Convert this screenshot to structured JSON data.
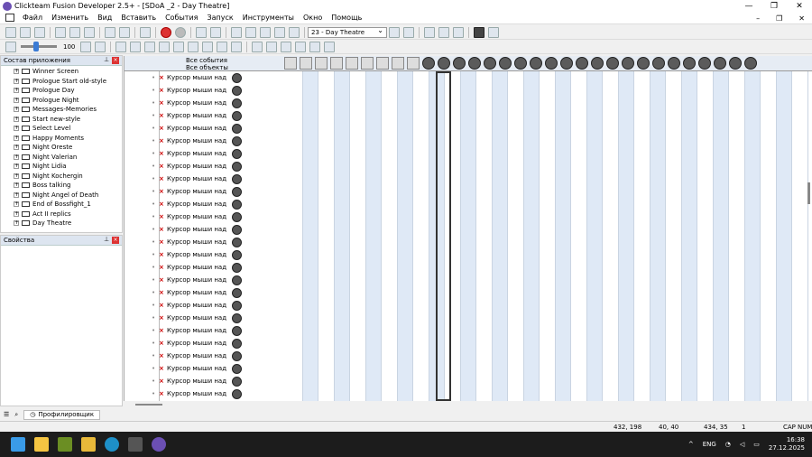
{
  "window": {
    "title": "Clickteam Fusion Developer 2.5+ - [SDoA _2 - Day Theatre]"
  },
  "menu": [
    "Файл",
    "Изменить",
    "Вид",
    "Вставить",
    "События",
    "Запуск",
    "Инструменты",
    "Окно",
    "Помощь"
  ],
  "toolbar": {
    "frame_select": "23 - Day Theatre",
    "zoom_value": "100"
  },
  "app_panel": {
    "title": "Состав приложения",
    "items": [
      "Winner Screen",
      "Prologue Start old-style",
      "Prologue Day",
      "Prologue Night",
      "Messages-Memories",
      "Start new-style",
      "Select Level",
      "Happy Moments",
      "Night Oreste",
      "Night Valerian",
      "Night Lidia",
      "Night Kochergin",
      "Boss talking",
      "Night Angel of Death",
      "End of Bossfight_1",
      "Act II replics",
      "Day Theatre"
    ]
  },
  "props_panel": {
    "title": "Свойства"
  },
  "editor": {
    "header_all_events": "Все события",
    "header_all_objects": "Все объекты",
    "condition_text": "Курсор мыши над",
    "row_count": 26
  },
  "bottom_tab": {
    "profiler": "Профилировщик"
  },
  "status": {
    "coords1": "432, 198",
    "coords2": "40, 40",
    "coords3": "434, 35",
    "count": "1",
    "caps": "CAP",
    "num": "NUM"
  },
  "taskbar": {
    "lang": "ENG",
    "time": "16:38",
    "date": "27.12.2025"
  }
}
